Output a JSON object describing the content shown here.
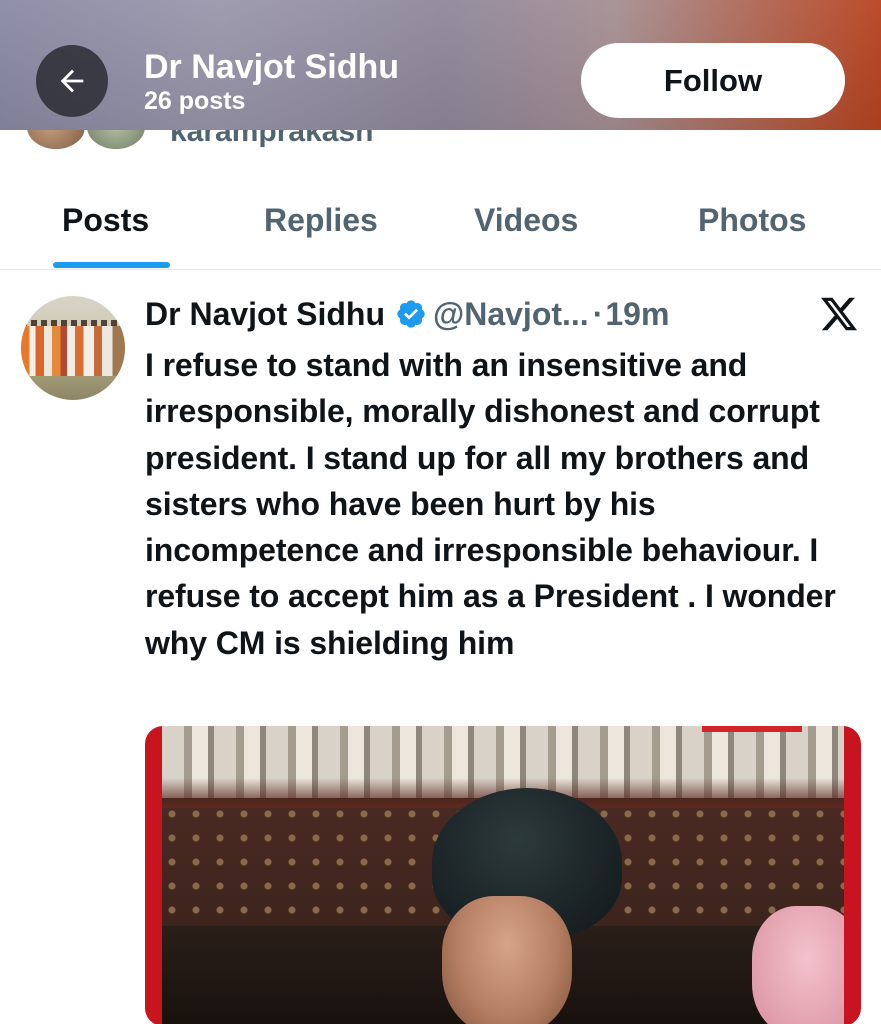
{
  "header": {
    "title": "Dr Navjot Sidhu",
    "posts_count": "26 posts",
    "follow_label": "Follow"
  },
  "followed_by": {
    "text": "karamprakash"
  },
  "tabs": [
    {
      "label": "Posts",
      "active": true
    },
    {
      "label": "Replies",
      "active": false
    },
    {
      "label": "Videos",
      "active": false
    },
    {
      "label": "Photos",
      "active": false
    }
  ],
  "post": {
    "author_name": "Dr Navjot Sidhu",
    "handle": "@Navjot...",
    "separator": "·",
    "time": "19m",
    "text": "I refuse to stand with an insensitive and irresponsible, morally dishonest and corrupt president. I stand up for all my brothers and sisters who have been hurt by his incompetence and irresponsible behaviour. I refuse to accept him as a President . I wonder why CM is shielding him",
    "source_icon": "x-logo-icon"
  },
  "colors": {
    "accent": "#1d9bf0",
    "text_primary": "#0f1419",
    "text_secondary": "#536471"
  }
}
